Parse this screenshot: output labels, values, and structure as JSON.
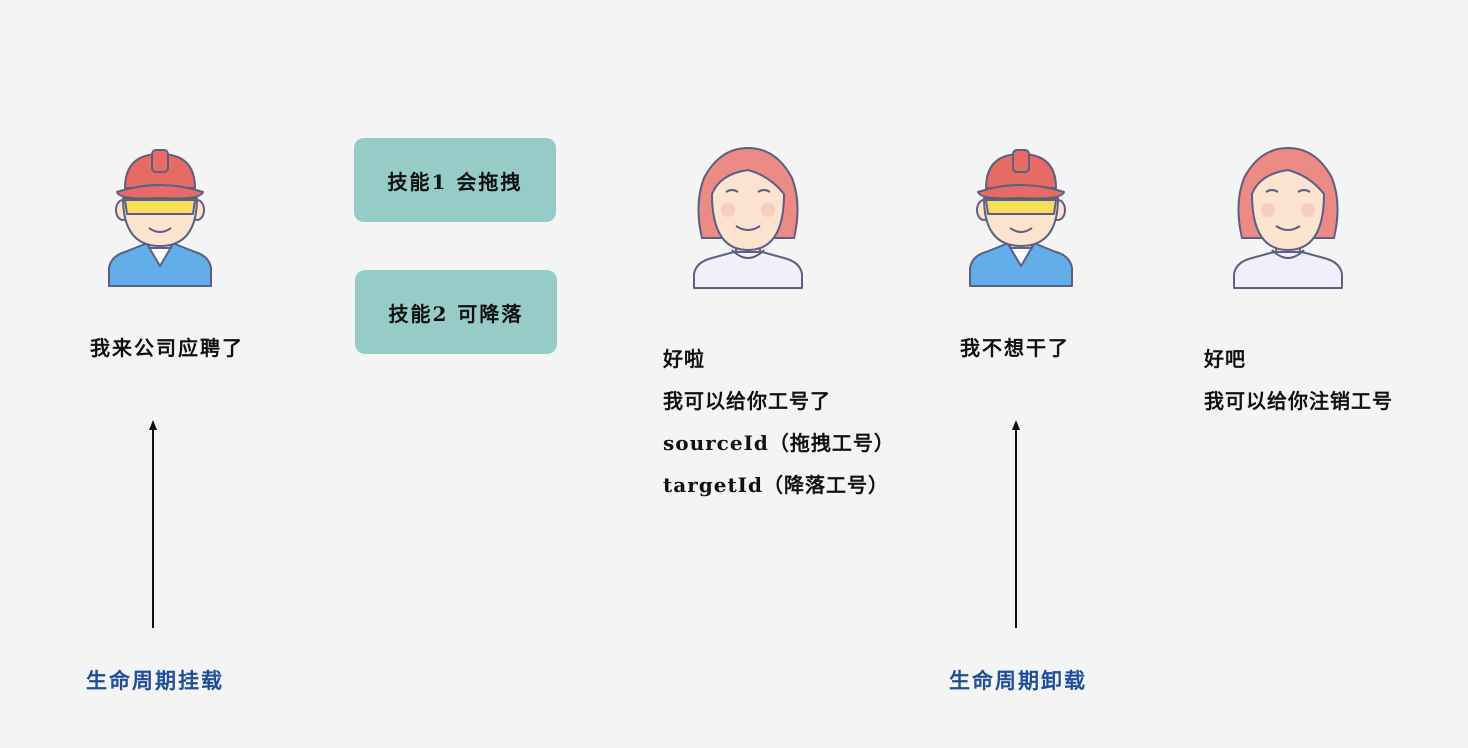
{
  "colors": {
    "skill_box": "#97cbc7",
    "lifecycle_text": "#1f4e9c",
    "helmet": "#e66b64",
    "hair": "#ec8a85",
    "skin": "#fbe3d0",
    "shirt_blue": "#63aee8",
    "shirt_white": "#f1f0fa",
    "outline": "#5b5f82"
  },
  "worker_mount": {
    "caption": "我来公司应聘了"
  },
  "skills": [
    {
      "label": "技能1 会拖拽"
    },
    {
      "label": "技能2 可降落"
    }
  ],
  "hr_mount": {
    "lines": [
      "好啦",
      "我可以给你工号了",
      "sourceId（拖拽工号）",
      "targetId（降落工号）"
    ]
  },
  "worker_unmount": {
    "caption": "我不想干了"
  },
  "hr_unmount": {
    "lines": [
      "好吧",
      "我可以给你注销工号"
    ]
  },
  "lifecycle": {
    "mount_label": "生命周期挂载",
    "unmount_label": "生命周期卸载"
  },
  "icons": {
    "worker": "worker-with-hard-hat-icon",
    "hr": "hr-woman-icon",
    "arrow": "arrow-up-icon"
  }
}
